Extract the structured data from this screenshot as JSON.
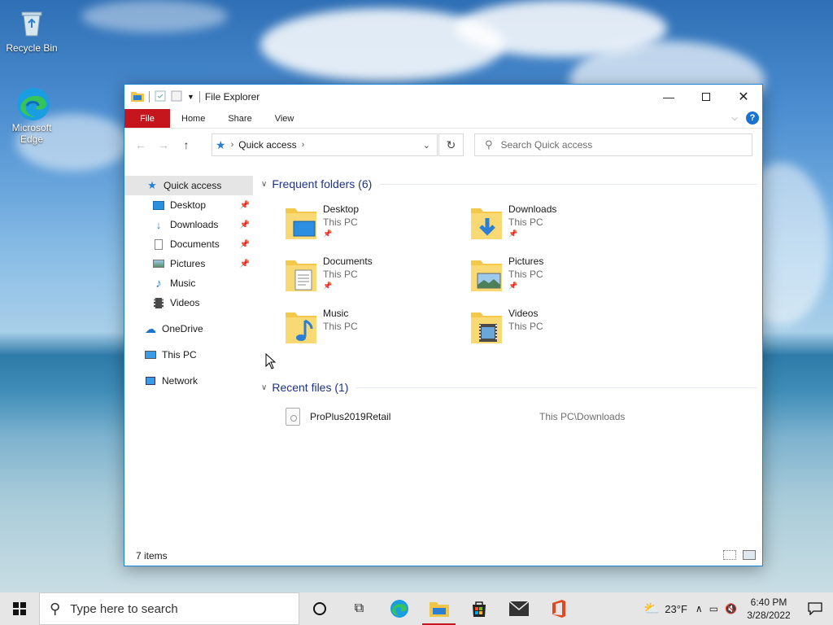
{
  "desktop": {
    "icons": [
      {
        "label": "Recycle Bin"
      },
      {
        "label": "Microsoft Edge"
      }
    ]
  },
  "window": {
    "title": "File Explorer",
    "ribbon": {
      "file": "File",
      "home": "Home",
      "share": "Share",
      "view": "View",
      "help": "?"
    },
    "address": {
      "location": "Quick access"
    },
    "search": {
      "placeholder": "Search Quick access"
    },
    "sidebar": {
      "items": [
        {
          "label": "Quick access"
        },
        {
          "label": "Desktop"
        },
        {
          "label": "Downloads"
        },
        {
          "label": "Documents"
        },
        {
          "label": "Pictures"
        },
        {
          "label": "Music"
        },
        {
          "label": "Videos"
        },
        {
          "label": "OneDrive"
        },
        {
          "label": "This PC"
        },
        {
          "label": "Network"
        }
      ]
    },
    "frequent": {
      "header": "Frequent folders (6)",
      "folders": [
        {
          "name": "Desktop",
          "location": "This PC"
        },
        {
          "name": "Downloads",
          "location": "This PC"
        },
        {
          "name": "Documents",
          "location": "This PC"
        },
        {
          "name": "Pictures",
          "location": "This PC"
        },
        {
          "name": "Music",
          "location": "This PC"
        },
        {
          "name": "Videos",
          "location": "This PC"
        }
      ]
    },
    "recent": {
      "header": "Recent files (1)",
      "files": [
        {
          "name": "ProPlus2019Retail",
          "path": "This PC\\Downloads"
        }
      ]
    },
    "status": {
      "items": "7 items"
    }
  },
  "taskbar": {
    "search_placeholder": "Type here to search",
    "weather": "23°F",
    "time": "6:40 PM",
    "date": "3/28/2022"
  }
}
